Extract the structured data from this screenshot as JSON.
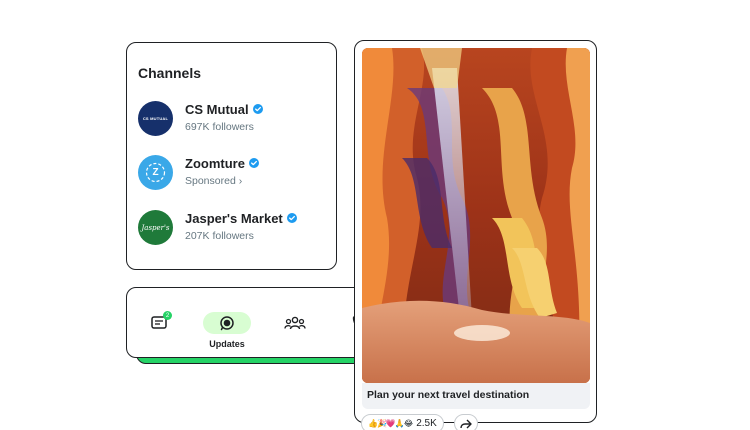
{
  "channels": {
    "title": "Channels",
    "items": [
      {
        "name": "CS Mutual",
        "subtitle": "697K followers",
        "avatar_text": "CS MUTUAL",
        "avatar_color": "#16306b"
      },
      {
        "name": "Zoomture",
        "subtitle": "Sponsored ›",
        "avatar_text": "Z",
        "avatar_color": "#3aa8e8"
      },
      {
        "name": "Jasper's Market",
        "subtitle": "207K followers",
        "avatar_text": "Jasper's",
        "avatar_color": "#1f7a3a"
      }
    ]
  },
  "nav": {
    "updates_label": "Updates",
    "chats_badge": "2"
  },
  "post": {
    "caption": "Plan your next travel destination",
    "reactions_emoji": "👍🎉💗🙏😂",
    "reactions_count": "2.5K"
  },
  "colors": {
    "accent_green": "#25d366",
    "verified_blue": "#1d9bf0",
    "outline": "#1f2124"
  }
}
